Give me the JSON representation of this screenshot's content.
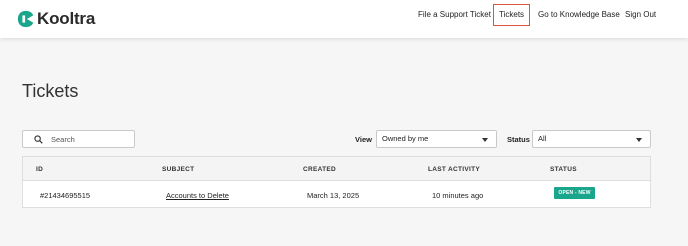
{
  "brand": {
    "name": "Kooltra",
    "logo_color": "#1aa68c"
  },
  "nav": {
    "items": [
      {
        "label": "File a Support Ticket"
      },
      {
        "label": "Tickets",
        "active": true
      },
      {
        "label": "Go to Knowledge Base"
      },
      {
        "label": "Sign Out"
      }
    ]
  },
  "page": {
    "title": "Tickets"
  },
  "search": {
    "placeholder": "Search",
    "value": ""
  },
  "filters": {
    "view": {
      "label": "View",
      "value": "Owned by me"
    },
    "status": {
      "label": "Status",
      "value": "All"
    }
  },
  "table": {
    "columns": [
      "ID",
      "SUBJECT",
      "CREATED",
      "LAST ACTIVITY",
      "STATUS"
    ],
    "rows": [
      {
        "id": "#21434695515",
        "subject": "Accounts to Delete",
        "created": "March 13, 2025",
        "last_activity": "10 minutes ago",
        "status": "OPEN - NEW",
        "status_color": "#1aa68c"
      }
    ]
  },
  "colors": {
    "active_outline": "#e0533d",
    "background": "#f6f6f7"
  }
}
